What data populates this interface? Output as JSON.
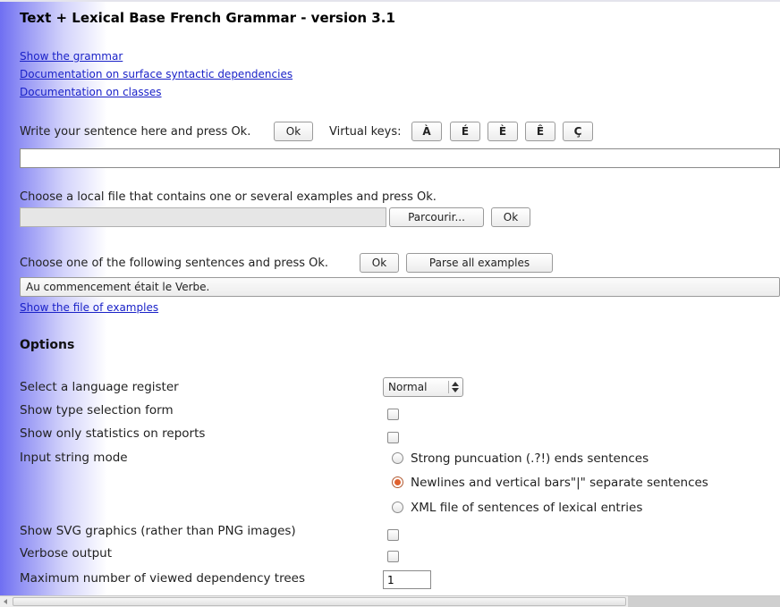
{
  "page": {
    "title": "Text + Lexical Base French Grammar - version 3.1",
    "links": [
      "Show the grammar",
      "Documentation on surface syntactic dependencies",
      "Documentation on classes"
    ]
  },
  "sentence_input": {
    "label": "Write your sentence here and press Ok.",
    "ok_label": "Ok",
    "virtual_keys_label": "Virtual keys:",
    "virtual_keys": [
      "À",
      "É",
      "È",
      "Ê",
      "Ç"
    ],
    "value": ""
  },
  "file_input": {
    "label": "Choose a local file that contains one or several examples and press Ok.",
    "browse_label": "Parcourir...",
    "ok_label": "Ok"
  },
  "examples": {
    "label": "Choose one of the following sentences and press Ok.",
    "ok_label": "Ok",
    "parse_all_label": "Parse all examples",
    "selected": "Au commencement était le Verbe.",
    "show_file_link": "Show the file of examples"
  },
  "options": {
    "heading": "Options",
    "register_label": "Select a language register",
    "register_value": "Normal",
    "type_selection_label": "Show type selection form",
    "type_selection_checked": false,
    "statistics_label": "Show only statistics on reports",
    "statistics_checked": false,
    "input_mode_label": "Input string mode",
    "input_modes": [
      {
        "label": "Strong puncuation (.?!) ends sentences",
        "checked": false
      },
      {
        "label": "Newlines and vertical bars\"|\" separate sentences",
        "checked": true
      },
      {
        "label": "XML file of sentences of lexical entries",
        "checked": false
      }
    ],
    "svg_label": "Show SVG graphics (rather than PNG images)",
    "svg_checked": false,
    "verbose_label": "Verbose output",
    "verbose_checked": false,
    "max_trees_label": "Maximum number of viewed dependency trees",
    "max_trees_value": "1"
  },
  "colors": {
    "link": "#1a22c8",
    "gradient_start": "#6f6ff2",
    "radio_checked": "#e0612e"
  }
}
